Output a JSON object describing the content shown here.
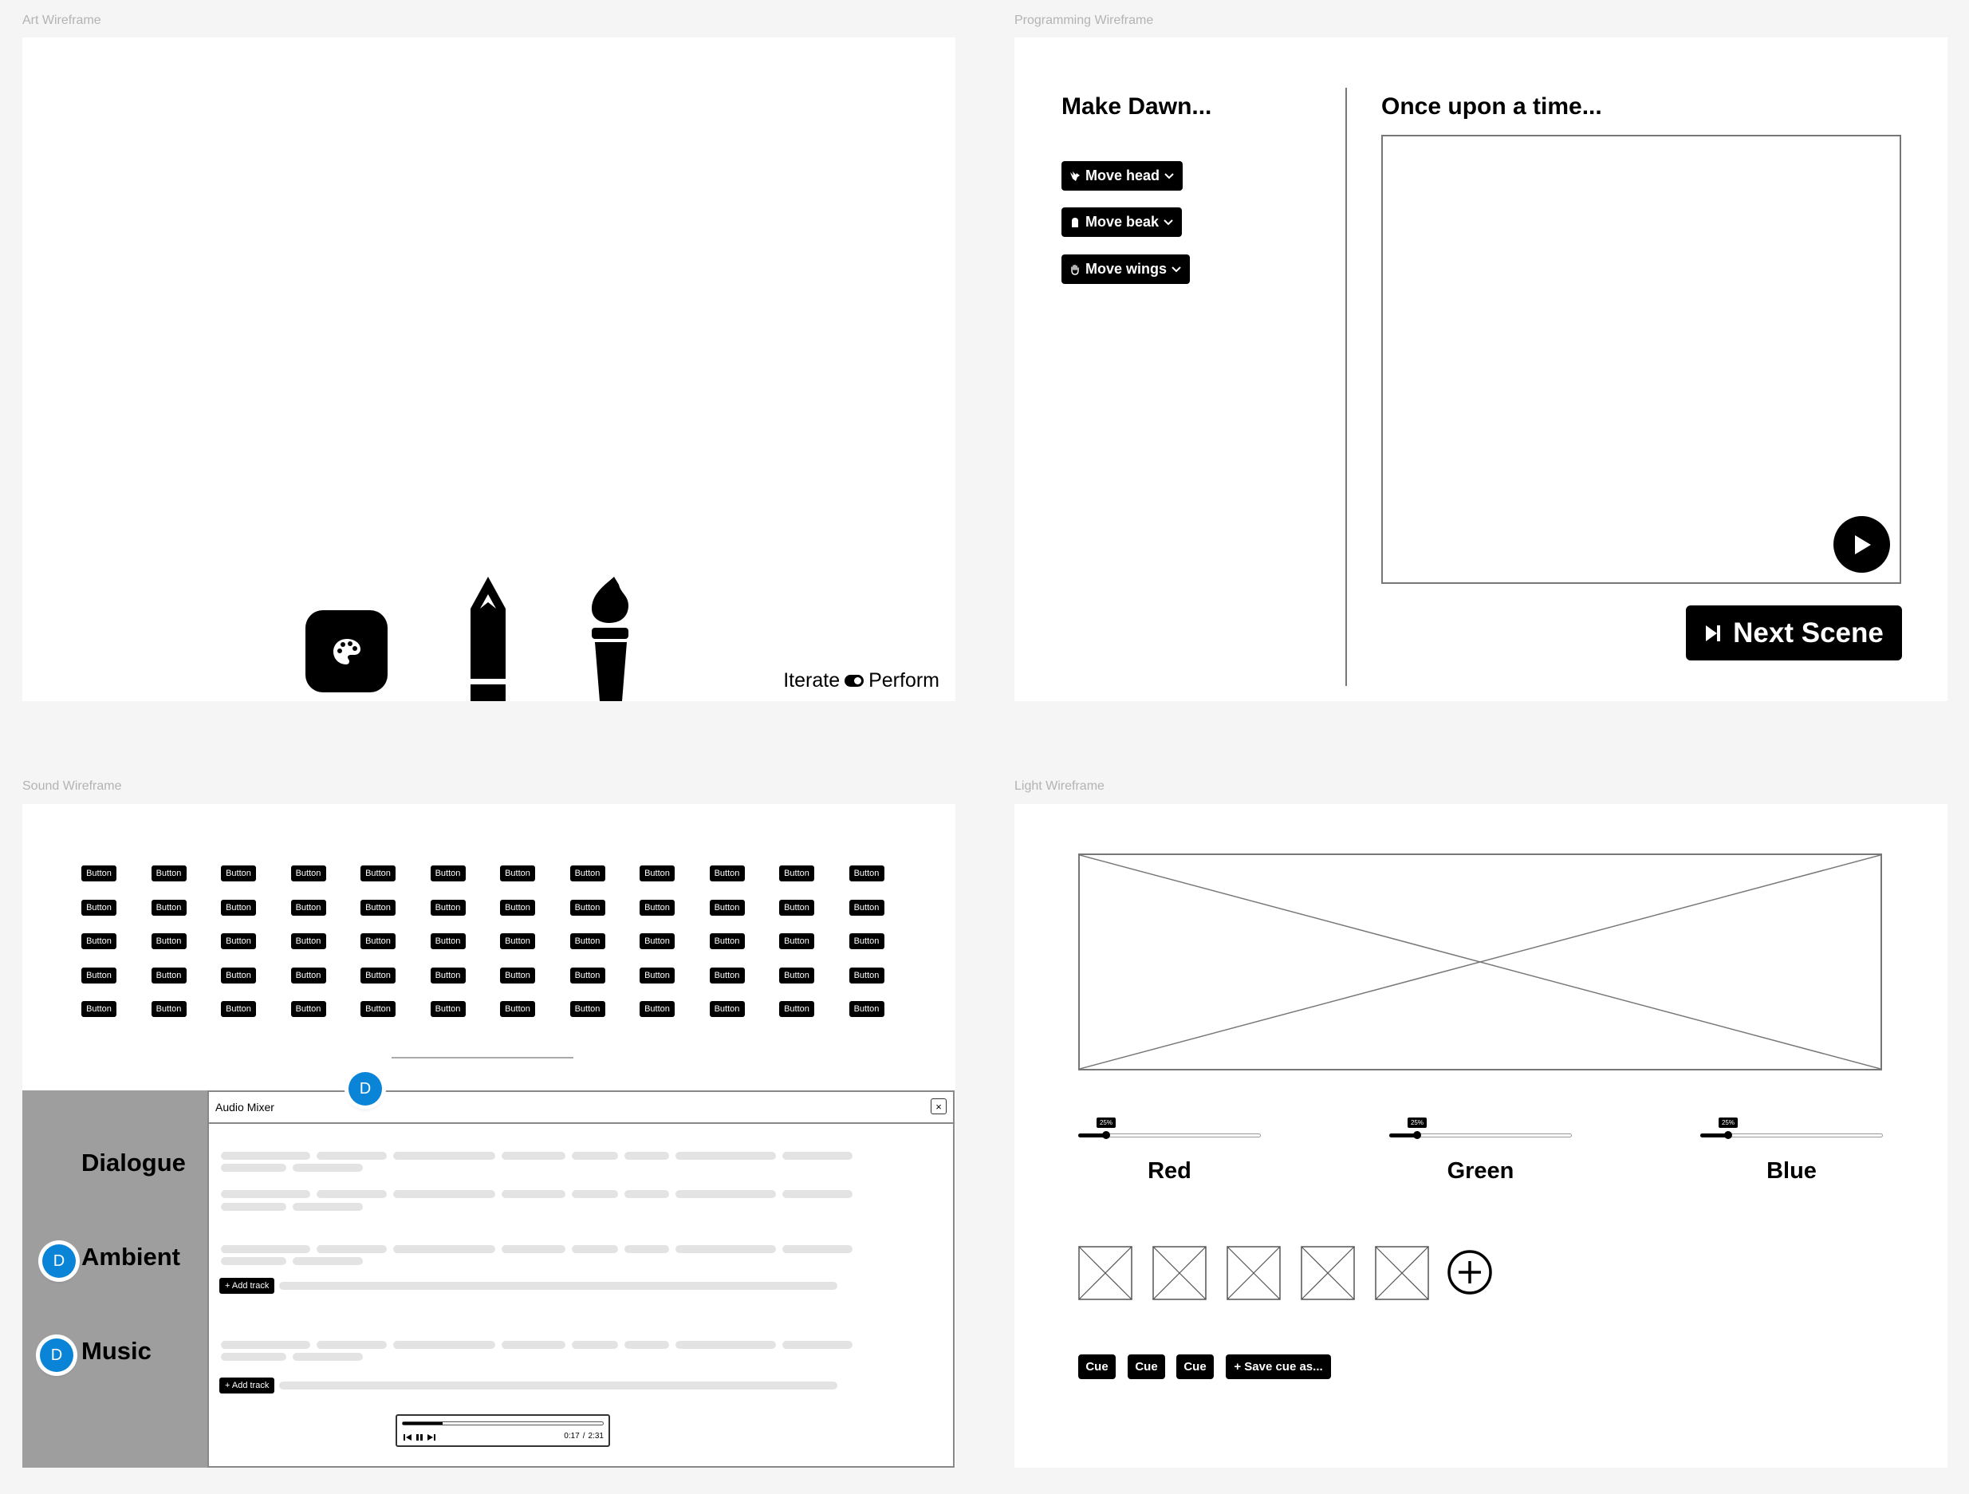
{
  "frames": {
    "art": {
      "label": "Art Wireframe"
    },
    "programming": {
      "label": "Programming Wireframe"
    },
    "sound": {
      "label": "Sound Wireframe"
    },
    "light": {
      "label": "Light Wireframe"
    }
  },
  "art": {
    "tools": [
      {
        "name": "palette",
        "icon": "palette-icon"
      },
      {
        "name": "pencil",
        "icon": "pencil-icon"
      },
      {
        "name": "brush",
        "icon": "brush-icon"
      }
    ],
    "toggle": {
      "left_label": "Iterate",
      "right_label": "Perform",
      "state": "Perform"
    }
  },
  "programming": {
    "left_title": "Make Dawn...",
    "right_title": "Once upon a time...",
    "chips": [
      {
        "label": "Move head",
        "icon": "bird-icon"
      },
      {
        "label": "Move beak",
        "icon": "beak-icon"
      },
      {
        "label": "Move wings",
        "icon": "hand-icon"
      }
    ],
    "next_button": "Next Scene"
  },
  "sound": {
    "grid_button_label": "Button",
    "grid_rows": 5,
    "grid_cols": 12,
    "categories": [
      "Dialogue",
      "Ambient",
      "Music"
    ],
    "avatar_letter": "D",
    "mixer": {
      "title": "Audio Mixer",
      "close": "×",
      "add_track": "+ Add track",
      "player": {
        "current": "0:17",
        "separator": "/",
        "total": "2:31",
        "progress": 0.2
      }
    }
  },
  "light": {
    "sliders": [
      {
        "label": "Red",
        "value_text": "25%",
        "value": 0.25
      },
      {
        "label": "Green",
        "value_text": "25%",
        "value": 0.25
      },
      {
        "label": "Blue",
        "value_text": "25%",
        "value": 0.25
      }
    ],
    "cues": [
      "Cue",
      "Cue",
      "Cue"
    ],
    "save_cue": "+ Save cue as..."
  }
}
